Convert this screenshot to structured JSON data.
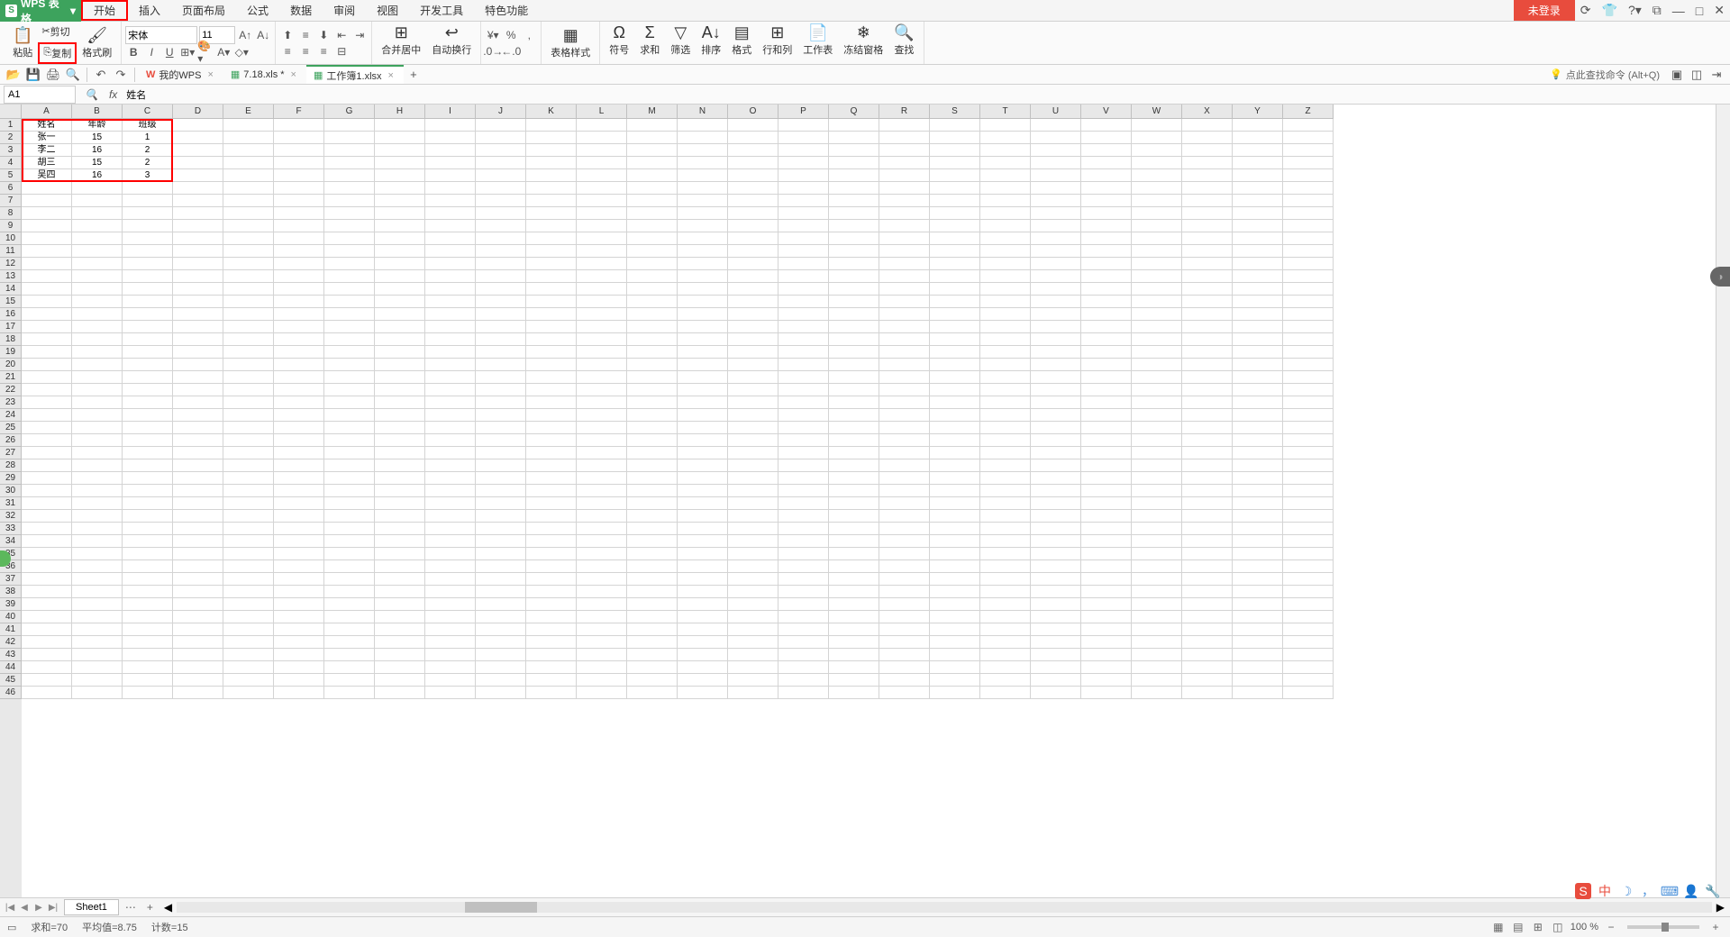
{
  "app": {
    "name": "WPS 表格",
    "logo_letter": "S"
  },
  "menu": {
    "items": [
      "开始",
      "插入",
      "页面布局",
      "公式",
      "数据",
      "审阅",
      "视图",
      "开发工具",
      "特色功能"
    ],
    "login": "未登录"
  },
  "ribbon": {
    "paste": "粘贴",
    "cut": "剪切",
    "copy": "复制",
    "format_painter": "格式刷",
    "font": "宋体",
    "font_size": "11",
    "merge_center": "合并居中",
    "auto_wrap": "自动换行",
    "table_style": "表格样式",
    "symbol": "符号",
    "sum": "求和",
    "filter": "筛选",
    "sort": "排序",
    "format": "格式",
    "row_col": "行和列",
    "worksheet": "工作表",
    "freeze": "冻结窗格",
    "find": "查找"
  },
  "quick_access": {
    "my_wps": "我的WPS",
    "doc1": "7.18.xls *",
    "doc2": "工作簿1.xlsx",
    "find_cmd": "点此查找命令 (Alt+Q)"
  },
  "formula": {
    "cell_ref": "A1",
    "value": "姓名"
  },
  "columns": [
    "A",
    "B",
    "C",
    "D",
    "E",
    "F",
    "G",
    "H",
    "I",
    "J",
    "K",
    "L",
    "M",
    "N",
    "O",
    "P",
    "Q",
    "R",
    "S",
    "T",
    "U",
    "V",
    "W",
    "X",
    "Y",
    "Z"
  ],
  "row_count": 46,
  "data": {
    "headers": [
      "姓名",
      "年龄",
      "班级"
    ],
    "rows": [
      [
        "张一",
        "15",
        "1"
      ],
      [
        "李二",
        "16",
        "2"
      ],
      [
        "胡三",
        "15",
        "2"
      ],
      [
        "吴四",
        "16",
        "3"
      ]
    ]
  },
  "sheet": {
    "name": "Sheet1"
  },
  "status": {
    "sum": "求和=70",
    "avg": "平均值=8.75",
    "count": "计数=15",
    "zoom": "100 %"
  }
}
